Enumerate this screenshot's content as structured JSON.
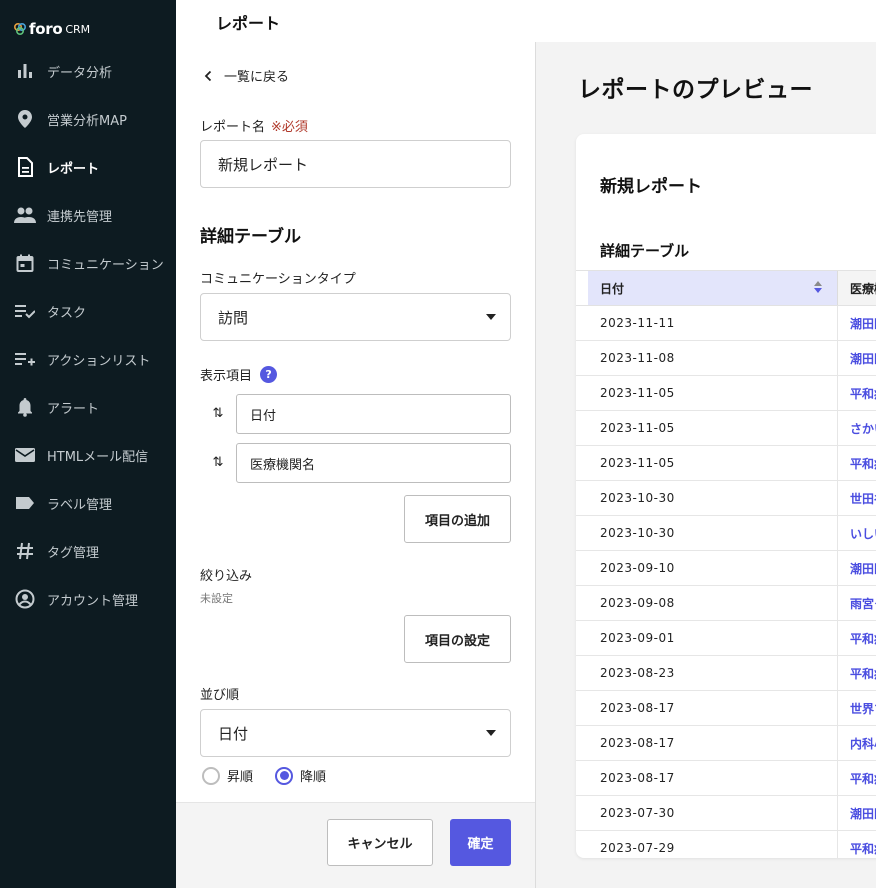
{
  "brand": {
    "name": "foro",
    "suffix": "CRM"
  },
  "sidebar": {
    "items": [
      {
        "label": "データ分析",
        "icon": "bar-chart-icon",
        "active": false
      },
      {
        "label": "営業分析MAP",
        "icon": "map-pin-icon",
        "active": false
      },
      {
        "label": "レポート",
        "icon": "document-icon",
        "active": true
      },
      {
        "label": "連携先管理",
        "icon": "people-icon",
        "active": false
      },
      {
        "label": "コミュニケーション",
        "icon": "calendar-icon",
        "active": false
      },
      {
        "label": "タスク",
        "icon": "task-list-icon",
        "active": false
      },
      {
        "label": "アクションリスト",
        "icon": "playlist-add-icon",
        "active": false
      },
      {
        "label": "アラート",
        "icon": "bell-icon",
        "active": false
      },
      {
        "label": "HTMLメール配信",
        "icon": "mail-icon",
        "active": false
      },
      {
        "label": "ラベル管理",
        "icon": "label-icon",
        "active": false
      },
      {
        "label": "タグ管理",
        "icon": "hash-icon",
        "active": false
      },
      {
        "label": "アカウント管理",
        "icon": "account-circle-icon",
        "active": false
      }
    ]
  },
  "header": {
    "title": "レポート"
  },
  "form": {
    "back_label": "一覧に戻る",
    "report_name_label": "レポート名",
    "required_label": "※必須",
    "report_name_value": "新規レポート",
    "detail_table_heading": "詳細テーブル",
    "comm_type_label": "コミュニケーションタイプ",
    "comm_type_value": "訪問",
    "display_items_label": "表示項目",
    "help_glyph": "?",
    "display_items": [
      "日付",
      "医療機関名"
    ],
    "add_item_button": "項目の追加",
    "filter_label": "絞り込み",
    "filter_status": "未設定",
    "filter_button": "項目の設定",
    "sort_label": "並び順",
    "sort_value": "日付",
    "sort_options": [
      {
        "label": "昇順",
        "selected": false
      },
      {
        "label": "降順",
        "selected": true
      }
    ],
    "cancel_button": "キャンセル",
    "confirm_button": "確定"
  },
  "preview": {
    "title": "レポートのプレビュー",
    "report_title": "新規レポート",
    "table_heading": "詳細テーブル",
    "columns": [
      "日付",
      "医療機"
    ],
    "rows": [
      [
        "2023-11-11",
        "潮田医"
      ],
      [
        "2023-11-08",
        "潮田医"
      ],
      [
        "2023-11-05",
        "平和病"
      ],
      [
        "2023-11-05",
        "さかい"
      ],
      [
        "2023-11-05",
        "平和病"
      ],
      [
        "2023-10-30",
        "世田谷"
      ],
      [
        "2023-10-30",
        "いしい"
      ],
      [
        "2023-09-10",
        "潮田医"
      ],
      [
        "2023-09-08",
        "雨宮ク"
      ],
      [
        "2023-09-01",
        "平和病"
      ],
      [
        "2023-08-23",
        "平和病"
      ],
      [
        "2023-08-17",
        "世界ち"
      ],
      [
        "2023-08-17",
        "内科小"
      ],
      [
        "2023-08-17",
        "平和病"
      ],
      [
        "2023-07-30",
        "潮田医"
      ],
      [
        "2023-07-29",
        "平和病"
      ]
    ]
  },
  "colors": {
    "accent": "#5558e0",
    "sidebar_bg": "#0d1b21",
    "required": "#b0392b"
  }
}
